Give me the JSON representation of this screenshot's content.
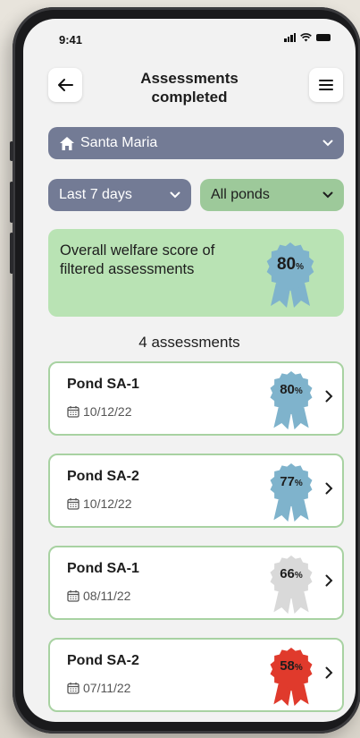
{
  "status": {
    "time": "9:41"
  },
  "header": {
    "title": "Assessments completed"
  },
  "filters": {
    "location": "Santa Maria",
    "period": "Last 7 days",
    "pond": "All ponds"
  },
  "summary": {
    "text": "Overall welfare score of filtered assessments",
    "score": "80",
    "unit": "%",
    "color": "#7fb3cc"
  },
  "count_label": "4 assessments",
  "assessments": [
    {
      "name": "Pond SA-1",
      "date": "10/12/22",
      "score": "80",
      "unit": "%",
      "color": "#7fb3cc"
    },
    {
      "name": "Pond SA-2",
      "date": "10/12/22",
      "score": "77",
      "unit": "%",
      "color": "#7fb3cc"
    },
    {
      "name": "Pond SA-1",
      "date": "08/11/22",
      "score": "66",
      "unit": "%",
      "color": "#d9d9d9"
    },
    {
      "name": "Pond SA-2",
      "date": "07/11/22",
      "score": "58",
      "unit": "%",
      "color": "#e03a2c"
    }
  ],
  "icons": {
    "back": "arrow-left-icon",
    "menu": "hamburger-menu-icon",
    "home": "home-icon",
    "chevron": "chevron-down-icon",
    "calendar": "calendar-icon",
    "next": "chevron-right-icon",
    "badge": "rosette-badge-icon"
  }
}
